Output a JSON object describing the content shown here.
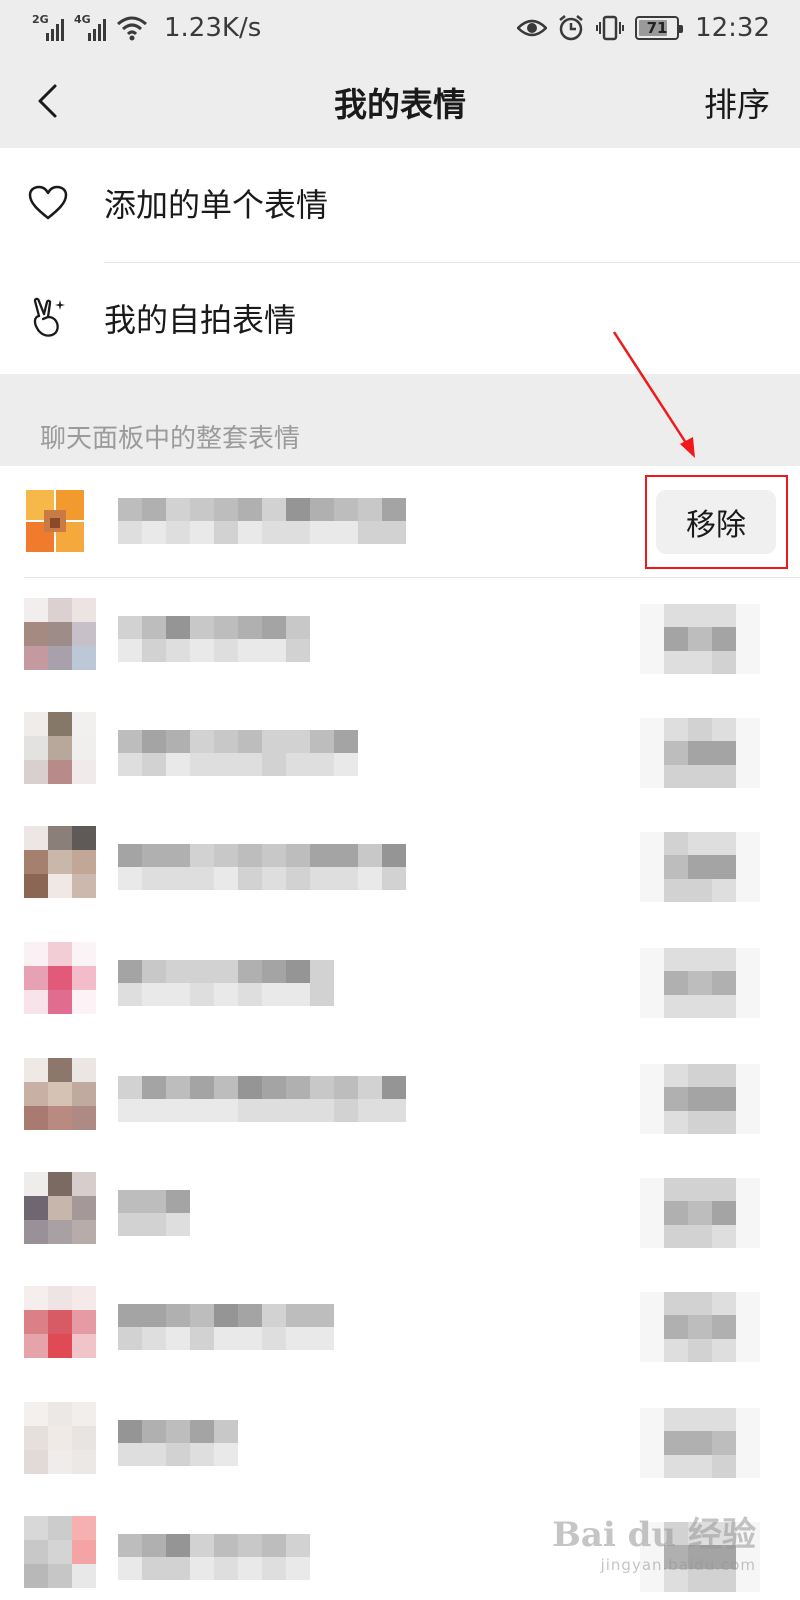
{
  "status_bar": {
    "network_1": "2G",
    "network_2": "4G",
    "speed": "1.23K/s",
    "battery": "71",
    "time": "12:32",
    "icons": [
      "signal-icon",
      "wifi-icon",
      "eye-icon",
      "alarm-icon",
      "vibrate-icon",
      "battery-icon"
    ]
  },
  "nav": {
    "title": "我的表情",
    "sort_label": "排序",
    "back_icon": "chevron-left-icon"
  },
  "menu": {
    "items": [
      {
        "label": "添加的单个表情",
        "icon": "heart-icon"
      },
      {
        "label": "我的自拍表情",
        "icon": "peace-hand-icon"
      }
    ]
  },
  "section": {
    "title": "聊天面板中的整套表情"
  },
  "packs": {
    "remove_label": "移除",
    "count": 10
  },
  "watermark": {
    "main": "Bai du 经验",
    "sub": "jingyan.baidu.com"
  },
  "colors": {
    "header_bg": "#ededed",
    "annotation": "#f01818",
    "section_text": "#9b9b9b"
  }
}
